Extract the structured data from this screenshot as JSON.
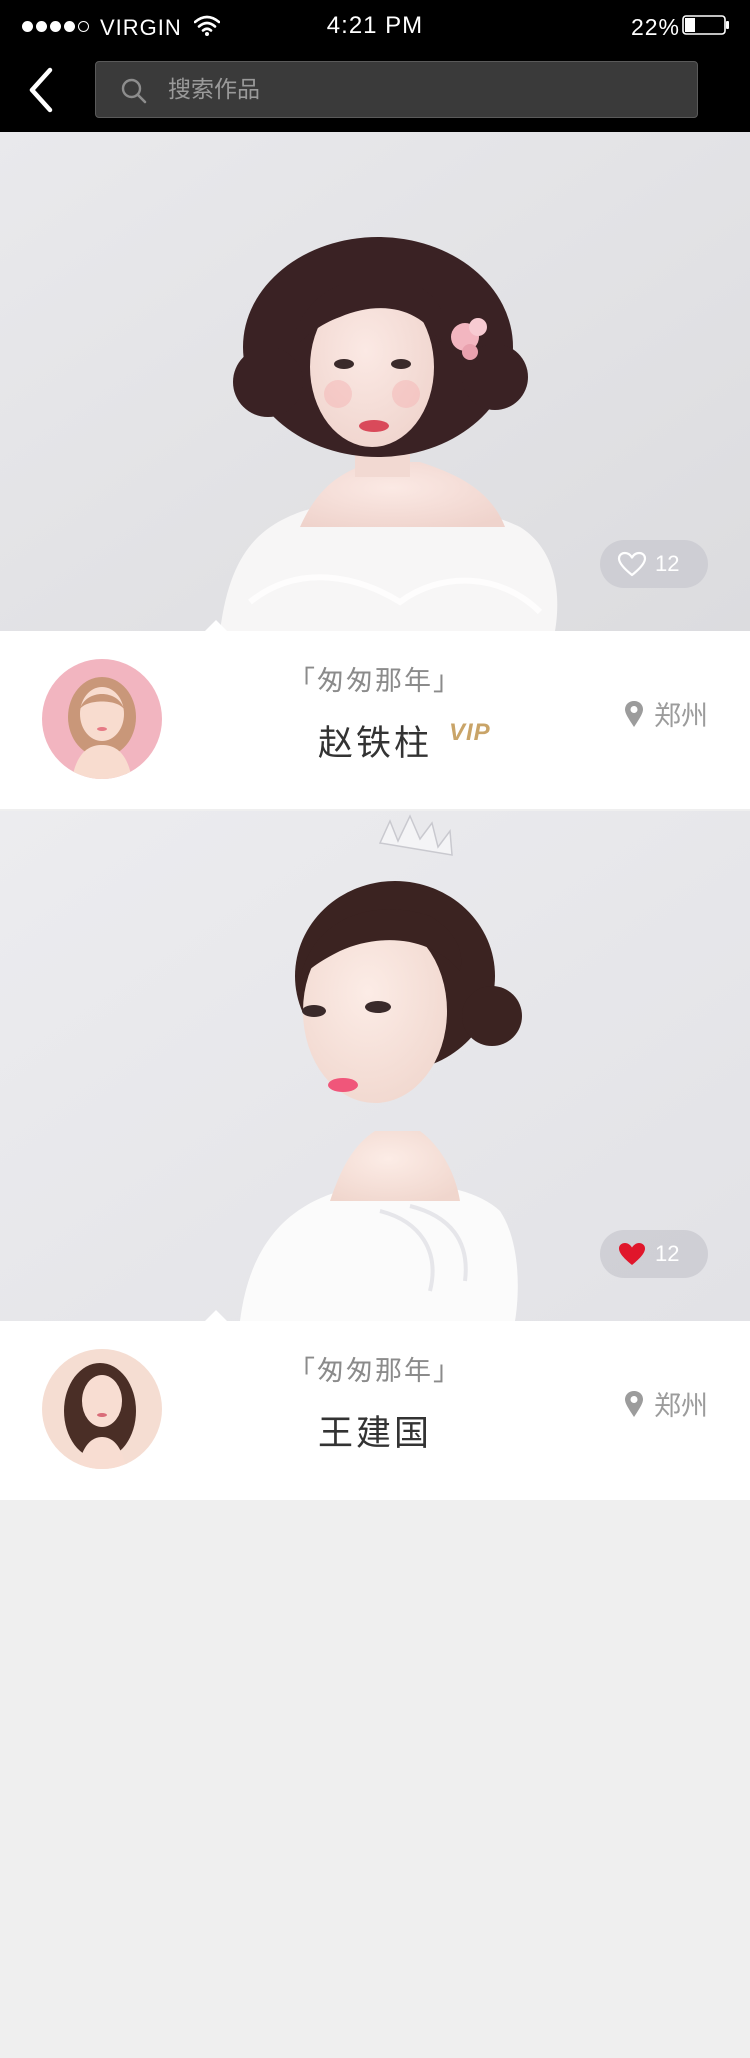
{
  "status_bar": {
    "carrier": "VIRGIN",
    "time": "4:21 PM",
    "battery": "22%"
  },
  "search": {
    "placeholder": "搜索作品"
  },
  "colors": {
    "header_bg": "#000000",
    "page_bg": "#efefef",
    "liked": "#e0162b",
    "vip": "#c9a468"
  },
  "works": [
    {
      "title": "「匆匆那年」",
      "author": "赵铁柱",
      "vip_label": "VIP",
      "location": "郑州",
      "likes": "12",
      "liked": false,
      "like_icon": "heart-outline-icon"
    },
    {
      "title": "「匆匆那年」",
      "author": "王建国",
      "location": "郑州",
      "likes": "12",
      "liked": true,
      "like_icon": "heart-filled-icon"
    }
  ]
}
